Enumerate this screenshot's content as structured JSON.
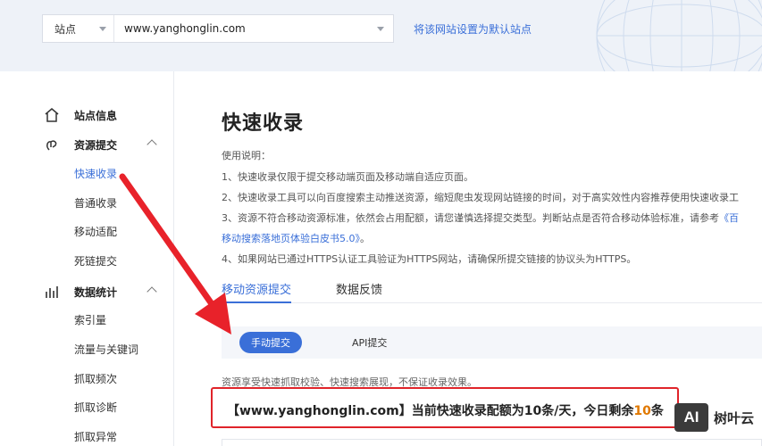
{
  "header": {
    "site_label": "站点",
    "site_value": "www.yanghonglin.com",
    "set_default_link": "将该网站设置为默认站点"
  },
  "sidebar": {
    "items": [
      {
        "label": "站点信息",
        "icon": "home-icon"
      },
      {
        "label": "资源提交",
        "icon": "resource-submit-icon"
      },
      {
        "label": "快速收录"
      },
      {
        "label": "普通收录"
      },
      {
        "label": "移动适配"
      },
      {
        "label": "死链提交"
      },
      {
        "label": "数据统计",
        "icon": "bar-chart-icon"
      },
      {
        "label": "索引量"
      },
      {
        "label": "流量与关键词"
      },
      {
        "label": "抓取频次"
      },
      {
        "label": "抓取诊断"
      },
      {
        "label": "抓取异常"
      }
    ],
    "active_item": "快速收录"
  },
  "main": {
    "title": "快速收录",
    "instructions": {
      "heading": "使用说明：",
      "line1": "1、快速收录仅限于提交移动端页面及移动端自适应页面。",
      "line2": "2、快速收录工具可以向百度搜索主动推送资源，缩短爬虫发现网站链接的时间，对于高实效性内容推荐使用快速收录工",
      "line3_prefix": "3、资源不符合移动资源标准，依然会占用配额，请您谨慎选择提交类型。判断站点是否符合移动体验标准，请参考",
      "line3_link": "《百",
      "line3b_link": "移动搜索落地页体验白皮书5.0》",
      "line3b_suffix": "。",
      "line4": "4、如果网站已通过HTTPS认证工具验证为HTTPS网站，请确保所提交链接的协议头为HTTPS。"
    },
    "tabs": [
      "移动资源提交",
      "数据反馈"
    ],
    "active_tab": "移动资源提交",
    "subtabs": [
      "手动提交",
      "API提交"
    ],
    "active_subtab": "手动提交",
    "note": "资源享受快速抓取校验、快速搜索展现，不保证收录效果。",
    "quota": {
      "prefix": "【www.yanghonglin.com】当前快速收录配额为",
      "quota_num": "10",
      "middle": "条/天，今日剩余",
      "remain_num": "10",
      "suffix": "条"
    }
  },
  "watermark": {
    "logo_text": "AI",
    "text": "树叶云"
  },
  "colors": {
    "accent": "#3a6fd8",
    "highlight_border": "#e0242a",
    "arrow": "#e8222a",
    "quota_number": "#e07800"
  }
}
